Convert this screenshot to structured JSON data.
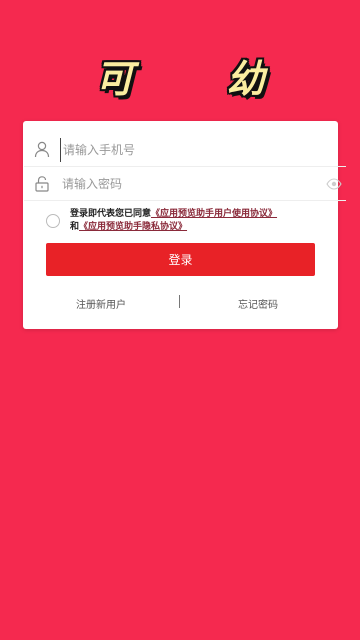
{
  "app": {
    "title": "可 幼"
  },
  "login_form": {
    "phone_placeholder": "请输入手机号",
    "password_placeholder": "请输入密码",
    "agreement_prefix": "登录即代表您已同意",
    "user_agreement_link": "《应用预览助手用户使用协议》",
    "agreement_and": "和",
    "privacy_link": "《应用预览助手隐私协议》",
    "login_button": "登录",
    "register_link": "注册新用户",
    "forgot_link": "忘记密码"
  },
  "icons": {
    "phone_field": "user-icon",
    "password_field": "lock-icon",
    "password_toggle": "eye-icon"
  },
  "colors": {
    "background": "#f5294f",
    "button": "#e82227",
    "title": "#fbeea0"
  }
}
